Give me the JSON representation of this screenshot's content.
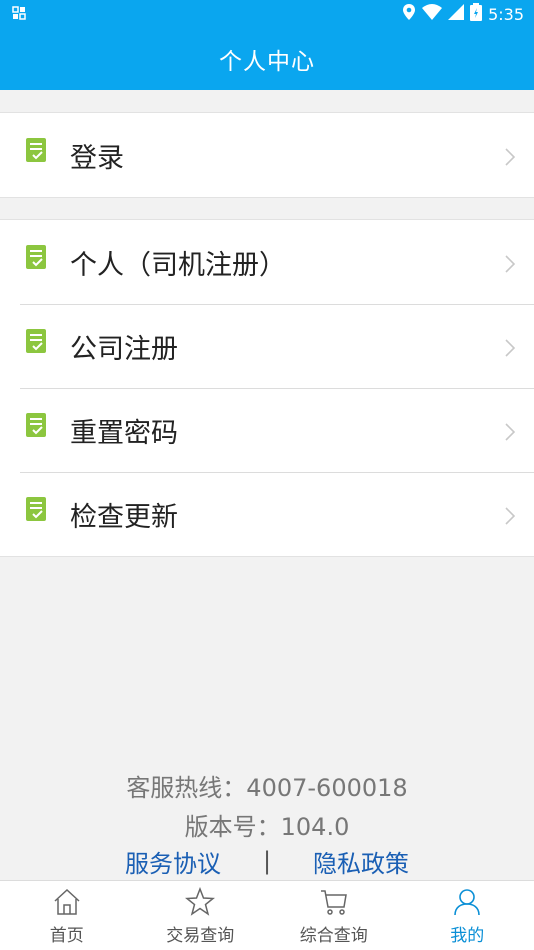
{
  "statusbar": {
    "time": "5:35"
  },
  "header": {
    "title": "个人中心"
  },
  "menu_group_1": [
    {
      "label": "登录",
      "icon": "document-check-icon"
    }
  ],
  "menu_group_2": [
    {
      "label": "个人（司机注册）",
      "icon": "document-check-icon"
    },
    {
      "label": "公司注册",
      "icon": "document-check-icon"
    },
    {
      "label": "重置密码",
      "icon": "document-check-icon"
    },
    {
      "label": "检查更新",
      "icon": "document-check-icon"
    }
  ],
  "footer": {
    "hotline": "客服热线：4007-600018",
    "version": "版本号：104.0",
    "service_agreement": "服务协议",
    "separator": "|",
    "privacy_policy": "隐私政策"
  },
  "tabs": [
    {
      "label": "首页",
      "icon": "home-icon",
      "active": false
    },
    {
      "label": "交易查询",
      "icon": "star-icon",
      "active": false
    },
    {
      "label": "综合查询",
      "icon": "cart-icon",
      "active": false
    },
    {
      "label": "我的",
      "icon": "person-icon",
      "active": true
    }
  ],
  "colors": {
    "primary": "#0aa6ef",
    "icon_green": "#8cc63f",
    "link": "#1a5fb4"
  }
}
